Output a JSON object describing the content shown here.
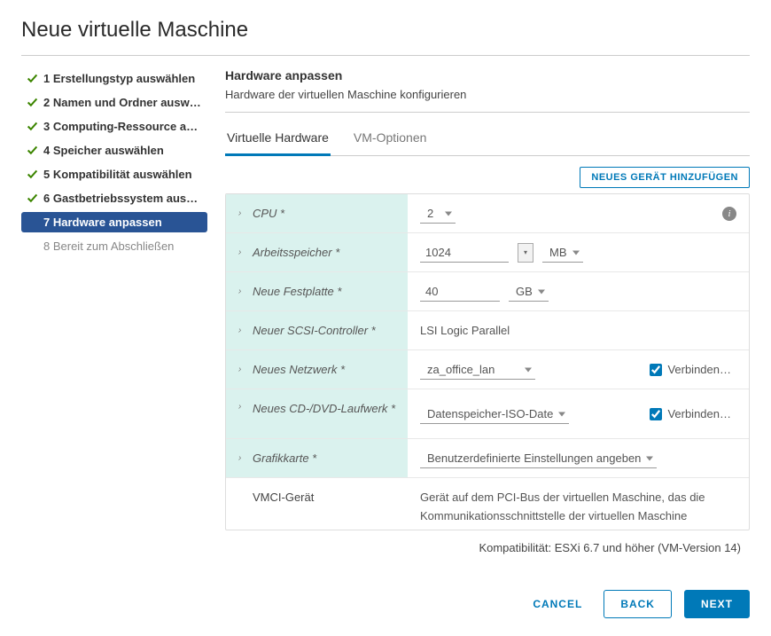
{
  "title": "Neue virtuelle Maschine",
  "steps": [
    {
      "label": "1 Erstellungstyp auswählen",
      "state": "done"
    },
    {
      "label": "2 Namen und Ordner ausw…",
      "state": "done"
    },
    {
      "label": "3 Computing-Ressource au…",
      "state": "done"
    },
    {
      "label": "4 Speicher auswählen",
      "state": "done"
    },
    {
      "label": "5 Kompatibilität auswählen",
      "state": "done"
    },
    {
      "label": "6 Gastbetriebssystem aus…",
      "state": "done"
    },
    {
      "label": "7 Hardware anpassen",
      "state": "active"
    },
    {
      "label": "8 Bereit zum Abschließen",
      "state": "pending"
    }
  ],
  "section": {
    "title": "Hardware anpassen",
    "subtitle": "Hardware der virtuellen Maschine konfigurieren"
  },
  "tabs": {
    "hw": "Virtuelle Hardware",
    "opts": "VM-Optionen"
  },
  "toolbar": {
    "add_device": "NEUES GERÄT HINZUFÜGEN"
  },
  "hardware": {
    "cpu": {
      "label": "CPU *",
      "value": "2"
    },
    "memory": {
      "label": "Arbeitsspeicher *",
      "value": "1024",
      "unit": "MB"
    },
    "disk": {
      "label": "Neue Festplatte *",
      "value": "40",
      "unit": "GB"
    },
    "scsi": {
      "label": "Neuer SCSI-Controller *",
      "value": "LSI Logic Parallel"
    },
    "network": {
      "label": "Neues Netzwerk *",
      "value": "za_office_lan",
      "connect": "Verbinden…",
      "checked": true
    },
    "cdrom": {
      "label": "Neues CD-/DVD-Laufwerk *",
      "value": "Datenspeicher-ISO-Date",
      "connect": "Verbinden…",
      "checked": true
    },
    "gpu": {
      "label": "Grafikkarte *",
      "value": "Benutzerdefinierte Einstellungen angeben"
    },
    "vmci": {
      "label": "VMCI-Gerät",
      "value": "Gerät auf dem PCI-Bus der virtuellen Maschine, das die Kommunikationsschnittstelle der virtuellen Maschine unterstützt"
    }
  },
  "compat": "Kompatibilität: ESXi 6.7 und höher (VM-Version 14)",
  "footer": {
    "cancel": "CANCEL",
    "back": "BACK",
    "next": "NEXT"
  }
}
